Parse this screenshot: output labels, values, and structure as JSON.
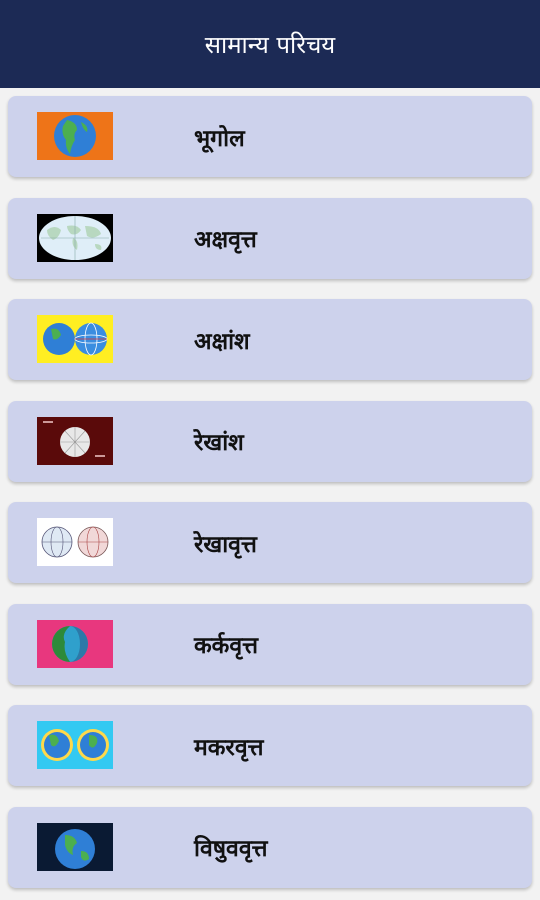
{
  "header": {
    "title": "सामान्य परिचय"
  },
  "items": [
    {
      "label": "भूगोल",
      "icon": "globe-americas-icon",
      "bg": "#ee7418"
    },
    {
      "label": "अक्षवृत्त",
      "icon": "world-map-icon",
      "bg": "#000000"
    },
    {
      "label": "अक्षांश",
      "icon": "latitude-globes-icon",
      "bg": "#ffee22"
    },
    {
      "label": "रेखांश",
      "icon": "longitude-diagram-icon",
      "bg": "#5a0a0a"
    },
    {
      "label": "रेखावृत्त",
      "icon": "meridian-globes-icon",
      "bg": "#ffffff"
    },
    {
      "label": "कर्कवृत्त",
      "icon": "tropic-cancer-globe-icon",
      "bg": "#e8377e"
    },
    {
      "label": "मकरवृत्त",
      "icon": "tropic-capricorn-globes-icon",
      "bg": "#33c9f2"
    },
    {
      "label": "विषुववृत्त",
      "icon": "equator-globe-icon",
      "bg": "#0a1a33"
    }
  ]
}
